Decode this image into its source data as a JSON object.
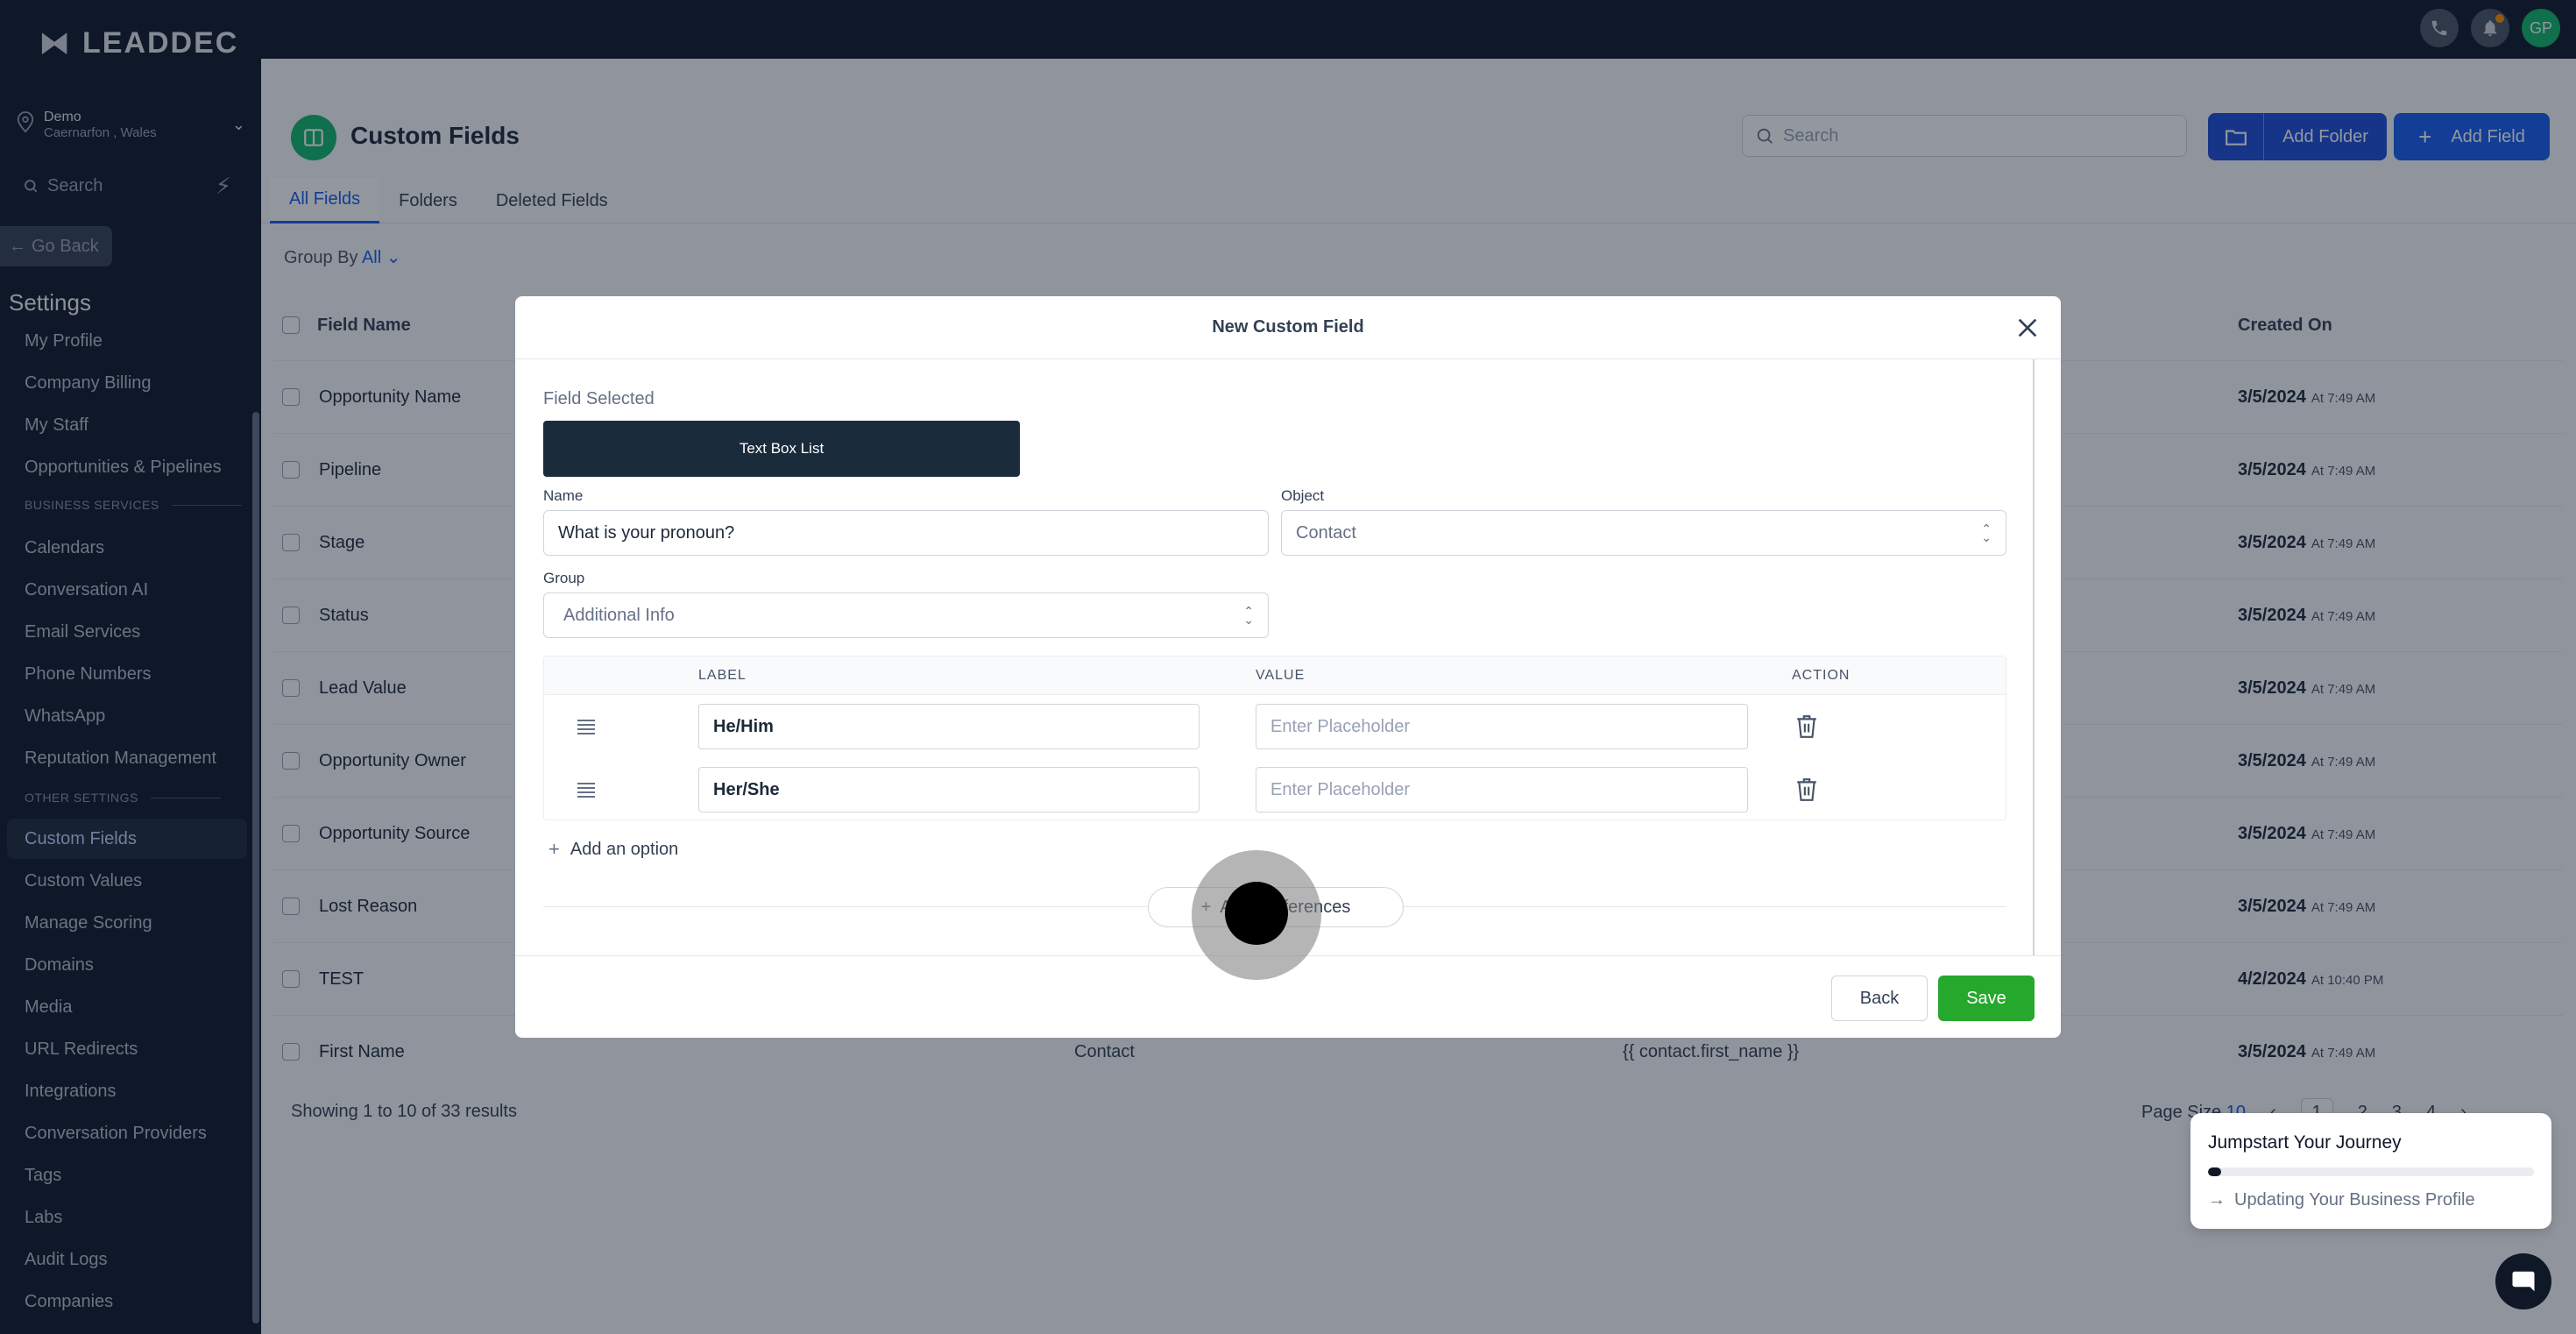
{
  "app": {
    "logo_text": "LEADDEC",
    "avatar_initials": "GP"
  },
  "sidebar": {
    "location_name": "Demo",
    "location_sub": "Caernarfon , Wales",
    "search_placeholder": "Search",
    "go_back": "Go Back",
    "settings_title": "Settings",
    "items_top": [
      "My Profile",
      "Company Billing",
      "My Staff",
      "Opportunities & Pipelines"
    ],
    "section_business": "BUSINESS SERVICES",
    "items_business": [
      "Calendars",
      "Conversation AI",
      "Email Services",
      "Phone Numbers",
      "WhatsApp",
      "Reputation Management"
    ],
    "section_other": "OTHER SETTINGS",
    "items_other": [
      "Custom Fields",
      "Custom Values",
      "Manage Scoring",
      "Domains",
      "Media",
      "URL Redirects",
      "Integrations",
      "Conversation Providers",
      "Tags",
      "Labs",
      "Audit Logs",
      "Companies"
    ],
    "active_item": "Custom Fields"
  },
  "page": {
    "title": "Custom Fields",
    "search_placeholder": "Search",
    "add_folder": "Add Folder",
    "add_field": "Add Field",
    "tabs": [
      "All Fields",
      "Folders",
      "Deleted Fields"
    ],
    "group_by_label": "Group By",
    "group_by_value": "All",
    "col_field_name": "Field Name",
    "col_created_on": "Created On",
    "rows": [
      {
        "name": "Opportunity Name",
        "date": "3/5/2024",
        "time": "At 7:49 AM"
      },
      {
        "name": "Pipeline",
        "date": "3/5/2024",
        "time": "At 7:49 AM"
      },
      {
        "name": "Stage",
        "date": "3/5/2024",
        "time": "At 7:49 AM"
      },
      {
        "name": "Status",
        "date": "3/5/2024",
        "time": "At 7:49 AM"
      },
      {
        "name": "Lead Value",
        "date": "3/5/2024",
        "time": "At 7:49 AM"
      },
      {
        "name": "Opportunity Owner",
        "date": "3/5/2024",
        "time": "At 7:49 AM"
      },
      {
        "name": "Opportunity Source",
        "date": "3/5/2024",
        "time": "At 7:49 AM"
      },
      {
        "name": "Lost Reason",
        "date": "3/5/2024",
        "time": "At 7:49 AM"
      },
      {
        "name": "TEST",
        "date": "4/2/2024",
        "time": "At 10:40 PM"
      },
      {
        "name": "First Name",
        "date": "3/5/2024",
        "time": "At 7:49 AM",
        "object": "Contact",
        "key": "{{ contact.first_name }}"
      }
    ],
    "showing_text": "Showing 1 to 10 of 33 results",
    "page_size_label": "Page Size",
    "page_size_value": "10",
    "pages": [
      "1",
      "2",
      "3",
      "4"
    ]
  },
  "modal": {
    "title": "New Custom Field",
    "field_selected_label": "Field Selected",
    "field_type": "Text Box List",
    "name_label": "Name",
    "name_value": "What is your pronoun?",
    "object_label": "Object",
    "object_value": "Contact",
    "group_label": "Group",
    "group_value": "Additional Info",
    "col_label": "LABEL",
    "col_value": "VALUE",
    "col_action": "ACTION",
    "options": [
      {
        "label": "He/Him",
        "value_placeholder": "Enter Placeholder"
      },
      {
        "label": "Her/She",
        "value_placeholder": "Enter Placeholder"
      }
    ],
    "add_option": "Add an option",
    "add_preferences": "Add Preferences",
    "back": "Back",
    "save": "Save"
  },
  "jumpstart": {
    "title": "Jumpstart Your Journey",
    "step": "Updating Your Business Profile",
    "progress_percent": 4
  }
}
